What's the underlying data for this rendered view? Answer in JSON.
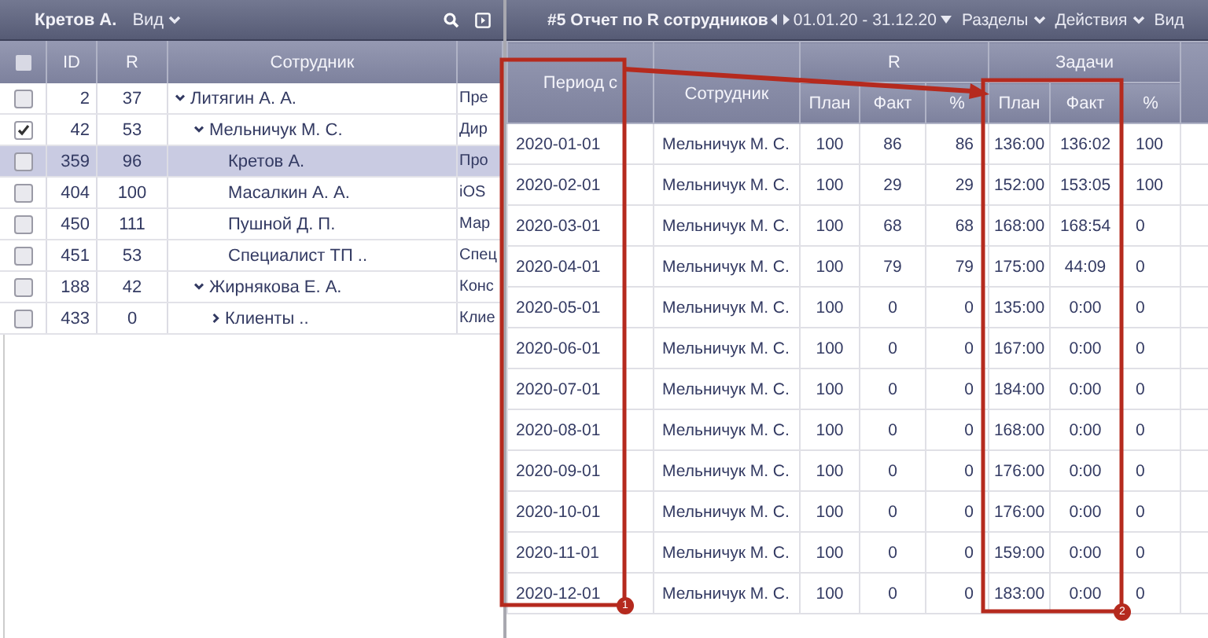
{
  "left_panel": {
    "title": "Кретов А.",
    "view_menu": "Вид",
    "table": {
      "columns": [
        "ID",
        "R",
        "Сотрудник"
      ],
      "rows": [
        {
          "id": "2",
          "r": "37",
          "name": "Литягин А. А.",
          "column_5": "Пре",
          "checked": false,
          "selected": false,
          "expanded": true,
          "children": [
            {
              "id": "42",
              "r": "53",
              "name": "Мельничук М. С.",
              "column_5": "Дир",
              "checked": true,
              "selected": false,
              "expanded": true,
              "children": [
                {
                  "id": "359",
                  "r": "96",
                  "name": "Кретов А.",
                  "column_5": "Про",
                  "checked": false,
                  "selected": true
                },
                {
                  "id": "404",
                  "r": "100",
                  "name": "Масалкин А. А.",
                  "column_5": "iOS",
                  "checked": false,
                  "selected": false
                },
                {
                  "id": "450",
                  "r": "111",
                  "name": "Пушной Д. П.",
                  "column_5": "Мар",
                  "checked": false,
                  "selected": false
                },
                {
                  "id": "451",
                  "r": "53",
                  "name": "Специалист ТП ..",
                  "column_5": "Спец",
                  "checked": false,
                  "selected": false
                }
              ]
            },
            {
              "id": "188",
              "r": "42",
              "name": "Жирнякова Е. А.",
              "column_5": "Конс",
              "checked": false,
              "selected": false,
              "expanded": true,
              "children": [
                {
                  "id": "433",
                  "r": "0",
                  "name": "Клиенты ..",
                  "column_5": "Клие",
                  "checked": false,
                  "selected": false,
                  "expanded": false
                }
              ]
            }
          ]
        }
      ]
    },
    "select_all": {
      "checked": false
    }
  },
  "right_panel": {
    "title": "#5 Отчет по R сотрудников",
    "date_range": "01.01.20 - 31.12.20",
    "menus": [
      "Разделы",
      "Действия"
    ],
    "view_menu": "Вид",
    "table": {
      "columns": [
        "Период с",
        "Сотрудник"
      ],
      "groups": [
        {
          "label": "R",
          "columns": [
            "План",
            "Факт",
            "%"
          ]
        },
        {
          "label": "Задачи",
          "columns": [
            "План",
            "Факт",
            "%"
          ]
        }
      ],
      "rows": [
        [
          "2020-01-01",
          "Мельничук М. С.",
          "100",
          "86",
          "86",
          "136:00",
          "136:02",
          "100"
        ],
        [
          "2020-02-01",
          "Мельничук М. С.",
          "100",
          "29",
          "29",
          "152:00",
          "153:05",
          "100"
        ],
        [
          "2020-03-01",
          "Мельничук М. С.",
          "100",
          "68",
          "68",
          "168:00",
          "168:54",
          "0"
        ],
        [
          "2020-04-01",
          "Мельничук М. С.",
          "100",
          "79",
          "79",
          "175:00",
          "44:09",
          "0"
        ],
        [
          "2020-05-01",
          "Мельничук М. С.",
          "100",
          "0",
          "0",
          "135:00",
          "0:00",
          "0"
        ],
        [
          "2020-06-01",
          "Мельничук М. С.",
          "100",
          "0",
          "0",
          "167:00",
          "0:00",
          "0"
        ],
        [
          "2020-07-01",
          "Мельничук М. С.",
          "100",
          "0",
          "0",
          "184:00",
          "0:00",
          "0"
        ],
        [
          "2020-08-01",
          "Мельничук М. С.",
          "100",
          "0",
          "0",
          "168:00",
          "0:00",
          "0"
        ],
        [
          "2020-09-01",
          "Мельничук М. С.",
          "100",
          "0",
          "0",
          "176:00",
          "0:00",
          "0"
        ],
        [
          "2020-10-01",
          "Мельничук М. С.",
          "100",
          "0",
          "0",
          "176:00",
          "0:00",
          "0"
        ],
        [
          "2020-11-01",
          "Мельничук М. С.",
          "100",
          "0",
          "0",
          "159:00",
          "0:00",
          "0"
        ],
        [
          "2020-12-01",
          "Мельничук М. С.",
          "100",
          "0",
          "0",
          "183:00",
          "0:00",
          "0"
        ]
      ]
    }
  },
  "annotations": [
    {
      "label": "1"
    },
    {
      "label": "2"
    }
  ]
}
